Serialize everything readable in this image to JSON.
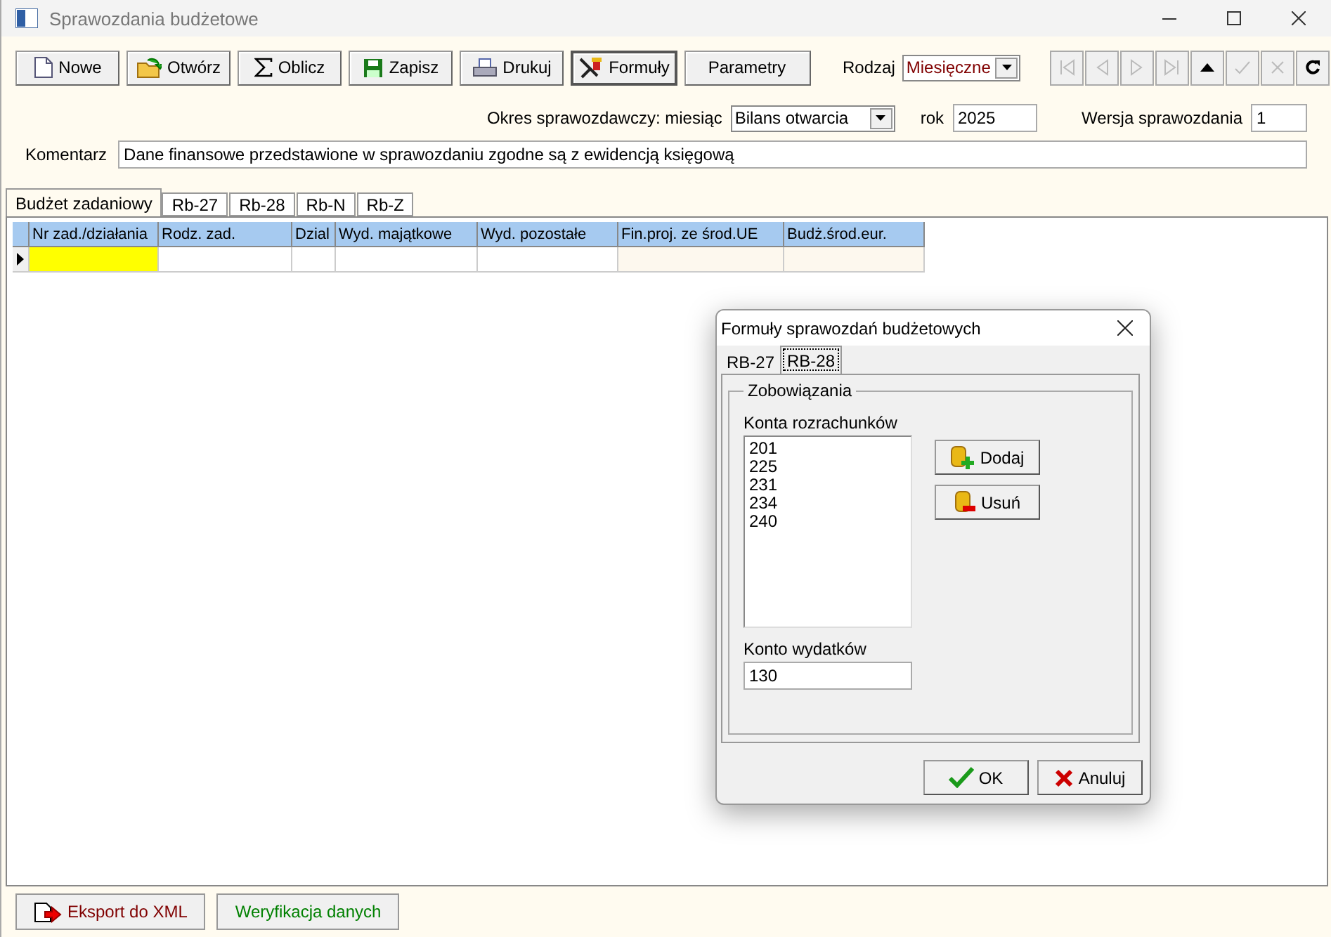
{
  "window": {
    "title": "Sprawozdania budżetowe"
  },
  "toolbar": [
    {
      "label": "Nowe",
      "kind": "new"
    },
    {
      "label": "Otwórz",
      "kind": "open"
    },
    {
      "label": "Oblicz",
      "kind": "sum"
    },
    {
      "label": "Zapisz",
      "kind": "save"
    },
    {
      "label": "Drukuj",
      "kind": "print"
    },
    {
      "label": "Formuły",
      "kind": "formulas"
    },
    {
      "label": "Parametry",
      "kind": "plain"
    }
  ],
  "rodzaj": {
    "label": "Rodzaj",
    "value": "Miesięczne"
  },
  "navigator": [
    {
      "kind": "first",
      "disabled": true
    },
    {
      "kind": "prior",
      "disabled": true
    },
    {
      "kind": "next",
      "disabled": true
    },
    {
      "kind": "last",
      "disabled": true
    },
    {
      "kind": "up",
      "disabled": false
    },
    {
      "kind": "post",
      "disabled": true
    },
    {
      "kind": "cancel",
      "disabled": true
    },
    {
      "kind": "refresh",
      "disabled": false
    }
  ],
  "okres": {
    "label": "Okres sprawozdawczy: miesiąc",
    "value": "Bilans otwarcia"
  },
  "rok": {
    "label": "rok",
    "value": "2025"
  },
  "wersja": {
    "label": "Wersja sprawozdania",
    "value": "1"
  },
  "komentarz": {
    "label": "Komentarz",
    "value": "Dane finansowe przedstawione w sprawozdaniu zgodne są z ewidencją księgową"
  },
  "tabs": [
    {
      "label": "Budżet zadaniowy",
      "selected": true
    },
    {
      "label": "Rb-27",
      "selected": false
    },
    {
      "label": "Rb-28",
      "selected": false
    },
    {
      "label": "Rb-N",
      "selected": false
    },
    {
      "label": "Rb-Z",
      "selected": false
    }
  ],
  "table": {
    "columns": [
      "Nr zad./działania",
      "Rodz. zad.",
      "Dzial",
      "Wyd. majątkowe",
      "Wyd. pozostałe",
      "Fin.proj. ze środ.UE",
      "Budż.środ.eur."
    ]
  },
  "dialog": {
    "title": "Formuły sprawozdań budżetowych",
    "tabs": [
      {
        "label": "RB-27",
        "selected": false
      },
      {
        "label": "RB-28",
        "selected": true
      }
    ],
    "group": "Zobowiązania",
    "accounts_label": "Konta rozrachunków",
    "accounts": [
      "201",
      "225",
      "231",
      "234",
      "240"
    ],
    "add_button": "Dodaj",
    "remove_button": "Usuń",
    "expense_label": "Konto wydatków",
    "expense_value": "130",
    "ok_button": "OK",
    "cancel_button": "Anuluj"
  },
  "bottom_buttons": [
    {
      "label": "Eksport do XML",
      "kind": "export"
    },
    {
      "label": "Weryfikacja danych",
      "kind": "verify"
    }
  ]
}
